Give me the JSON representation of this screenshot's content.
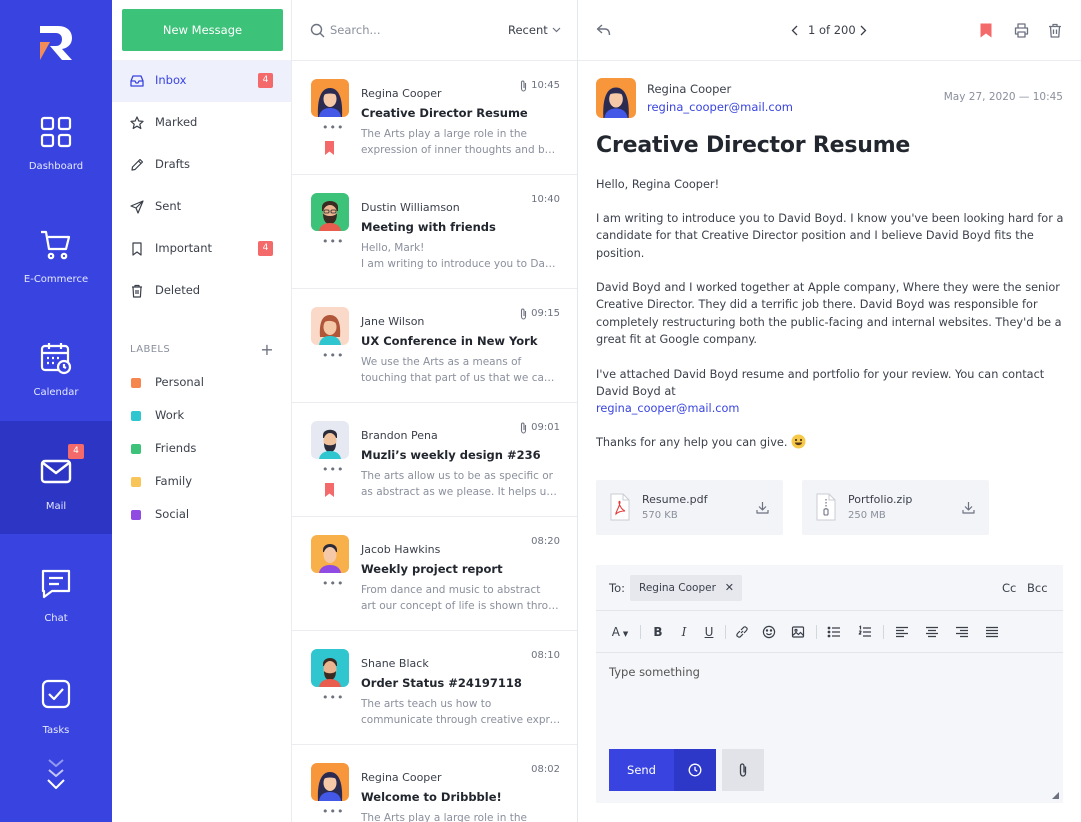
{
  "nav": {
    "items": [
      {
        "id": "dashboard",
        "label": "Dashboard"
      },
      {
        "id": "ecommerce",
        "label": "E-Commerce"
      },
      {
        "id": "calendar",
        "label": "Calendar"
      },
      {
        "id": "mail",
        "label": "Mail",
        "badge": "4"
      },
      {
        "id": "chat",
        "label": "Chat"
      },
      {
        "id": "tasks",
        "label": "Tasks"
      }
    ]
  },
  "folders": {
    "new_message": "New Message",
    "items": [
      {
        "label": "Inbox",
        "badge": "4",
        "icon": "inbox-icon"
      },
      {
        "label": "Marked",
        "icon": "star-icon"
      },
      {
        "label": "Drafts",
        "icon": "pencil-icon"
      },
      {
        "label": "Sent",
        "icon": "send-icon"
      },
      {
        "label": "Important",
        "badge": "4",
        "icon": "bookmark-icon"
      },
      {
        "label": "Deleted",
        "icon": "trash-icon"
      }
    ],
    "labels_heading": "LABELS",
    "labels": [
      {
        "label": "Personal",
        "color": "#f5874e"
      },
      {
        "label": "Work",
        "color": "#2fc6d0"
      },
      {
        "label": "Friends",
        "color": "#3cc279"
      },
      {
        "label": "Family",
        "color": "#f7c55a"
      },
      {
        "label": "Social",
        "color": "#8f4be2"
      }
    ]
  },
  "list": {
    "search_placeholder": "Search...",
    "sort": "Recent",
    "messages": [
      {
        "name": "Regina Cooper",
        "subject": "Creative Director Resume",
        "preview": [
          "The Arts play a large role in the",
          "expression of inner thoughts and beauty"
        ],
        "time": "10:45",
        "attachment": true,
        "flagged": true
      },
      {
        "name": "Dustin Williamson",
        "subject": "Meeting with friends",
        "preview": [
          "Hello, Mark!",
          "I am writing to introduce you to David Boyd"
        ],
        "time": "10:40",
        "attachment": false,
        "flagged": false
      },
      {
        "name": "Jane Wilson",
        "subject": "UX Conference in New York",
        "preview": [
          "We use the Arts as a means of",
          "touching that part of us that we cannot see"
        ],
        "time": "09:15",
        "attachment": true,
        "flagged": false
      },
      {
        "name": "Brandon Pena",
        "subject": "Muzli’s weekly design #236",
        "preview": [
          "The arts allow us to be as specific or",
          "as abstract as we please. It helps us grow"
        ],
        "time": "09:01",
        "attachment": true,
        "flagged": true
      },
      {
        "name": "Jacob Hawkins",
        "subject": "Weekly project report",
        "preview": [
          "From dance and music to abstract",
          "art our concept of life is shown through art"
        ],
        "time": "08:20",
        "attachment": false,
        "flagged": false
      },
      {
        "name": "Shane Black",
        "subject": "Order Status #24197118",
        "preview": [
          "The arts teach us how to",
          "communicate through creative expression"
        ],
        "time": "08:10",
        "attachment": false,
        "flagged": false
      },
      {
        "name": "Regina Cooper",
        "subject": "Welcome to Dribbble!",
        "preview": [
          "The Arts play a large role in the"
        ],
        "time": "08:02",
        "attachment": false,
        "flagged": false
      }
    ]
  },
  "reader": {
    "pager": "1 of 200",
    "sender_name": "Regina Cooper",
    "sender_email": "regina_cooper@mail.com",
    "date": "May 27, 2020 — 10:45",
    "title": "Creative Director Resume",
    "greeting": "Hello, Regina Cooper!",
    "paragraph_1": "I am writing to introduce you to David Boyd. I know you've been looking hard for a candidate for that Creative Director position and I believe David Boyd fits the position.",
    "paragraph_2": "David Boyd and I worked together at Apple company, Where they were the senior Creative Director. They did a terrific job there. David Boyd was responsible for completely restructuring both the public-facing and internal websites. They'd be a great fit at Google company.",
    "paragraph_3": "I've attached David Boyd resume and portfolio for your review. You can contact David Boyd at",
    "paragraph_link": "regina_cooper@mail.com",
    "thanks": "Thanks for any help you can give.",
    "attachments": [
      {
        "name": "Resume.pdf",
        "size": "570 KB"
      },
      {
        "name": "Portfolio.zip",
        "size": "250 MB"
      }
    ]
  },
  "compose": {
    "to_label": "To:",
    "recipient": "Regina Cooper",
    "cc": "Cc",
    "bcc": "Bcc",
    "placeholder": "Type something",
    "send": "Send",
    "font_glyph": "A",
    "bold_glyph": "B",
    "italic_glyph": "I",
    "underline_glyph": "U"
  },
  "colors": {
    "accent": "#3944e0",
    "green": "#3cc279",
    "badge": "#f46a6a"
  }
}
